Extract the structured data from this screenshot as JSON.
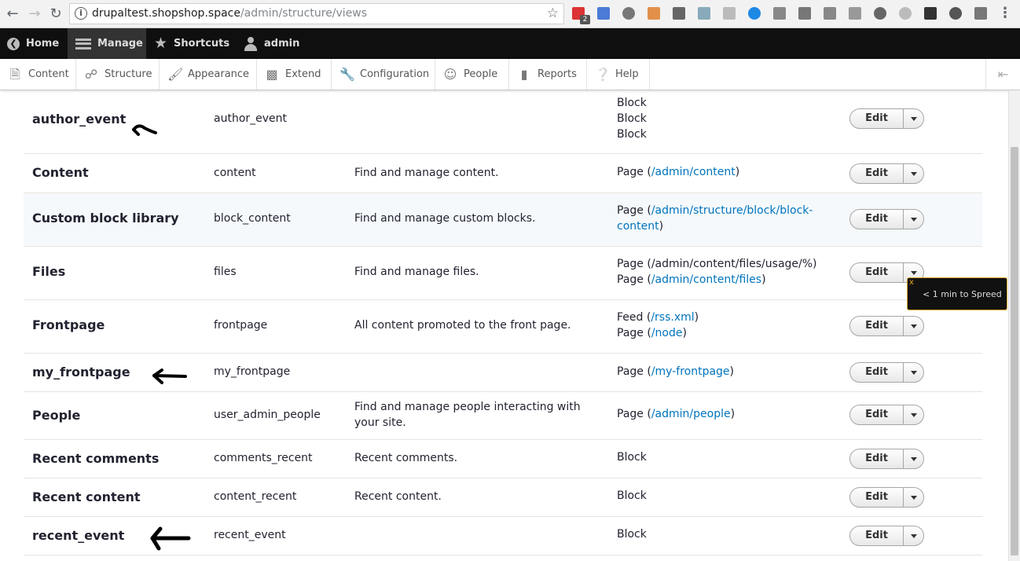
{
  "browser": {
    "url_host": "drupaltest.shopshop.space",
    "url_path": "/admin/structure/views",
    "extension_badge": "2"
  },
  "toolbar": {
    "home": "Home",
    "manage": "Manage",
    "shortcuts": "Shortcuts",
    "user": "admin"
  },
  "tray": {
    "items": [
      "Content",
      "Structure",
      "Appearance",
      "Extend",
      "Configuration",
      "People",
      "Reports",
      "Help"
    ]
  },
  "views": {
    "edit_label": "Edit",
    "rows": [
      {
        "name": "author_event",
        "machine": "author_event",
        "desc": "",
        "displays": [
          {
            "type": "Block"
          },
          {
            "type": "Block"
          },
          {
            "type": "Block"
          }
        ]
      },
      {
        "name": "Content",
        "machine": "content",
        "desc": "Find and manage content.",
        "displays": [
          {
            "type": "Page",
            "path": "/admin/content"
          }
        ]
      },
      {
        "name": "Custom block library",
        "machine": "block_content",
        "desc": "Find and manage custom blocks.",
        "displays": [
          {
            "type": "Page",
            "path": "/admin/structure/block/block-content"
          }
        ]
      },
      {
        "name": "Files",
        "machine": "files",
        "desc": "Find and manage files.",
        "displays": [
          {
            "type": "Page",
            "path_text": "/admin/content/files/usage/%"
          },
          {
            "type": "Page",
            "path": "/admin/content/files"
          }
        ]
      },
      {
        "name": "Frontpage",
        "machine": "frontpage",
        "desc": "All content promoted to the front page.",
        "displays": [
          {
            "type": "Feed",
            "path": "/rss.xml"
          },
          {
            "type": "Page",
            "path": "/node"
          }
        ]
      },
      {
        "name": "my_frontpage",
        "machine": "my_frontpage",
        "desc": "",
        "displays": [
          {
            "type": "Page",
            "path": "/my-frontpage"
          }
        ]
      },
      {
        "name": "People",
        "machine": "user_admin_people",
        "desc": "Find and manage people interacting with your site.",
        "displays": [
          {
            "type": "Page",
            "path": "/admin/people"
          }
        ]
      },
      {
        "name": "Recent comments",
        "machine": "comments_recent",
        "desc": "Recent comments.",
        "displays": [
          {
            "type": "Block"
          }
        ]
      },
      {
        "name": "Recent content",
        "machine": "content_recent",
        "desc": "Recent content.",
        "displays": [
          {
            "type": "Block"
          }
        ]
      },
      {
        "name": "recent_event",
        "machine": "recent_event",
        "desc": "",
        "displays": [
          {
            "type": "Block"
          }
        ]
      }
    ]
  },
  "tooltip": {
    "close": "x",
    "text": "< 1 min to Spreed"
  },
  "colors": {
    "toolbar_bg": "#0f0f0f",
    "link": "#0074bd",
    "row_highlight": "#f5f9fc"
  }
}
